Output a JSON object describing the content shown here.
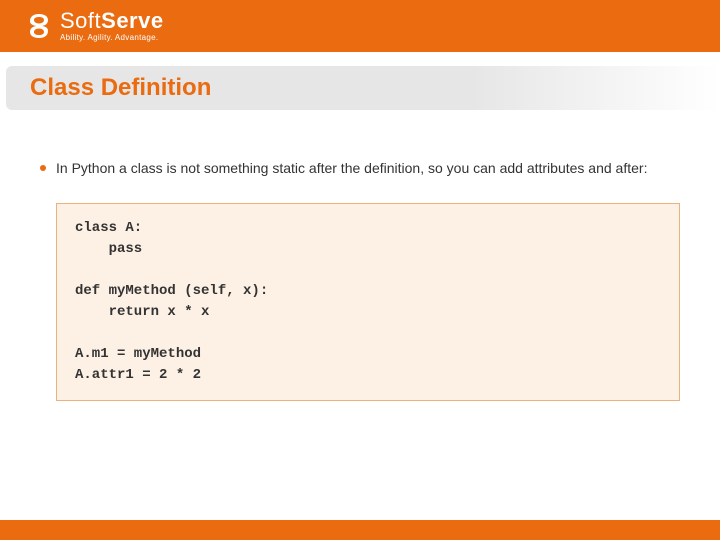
{
  "brand": {
    "name_light": "Soft",
    "name_bold": "Serve",
    "tagline": "Ability. Agility. Advantage."
  },
  "slide": {
    "title": "Class Definition",
    "bullet": "In Python a class is not something static after the definition, so you can add attributes and after:",
    "code": "class A:\n    pass\n\ndef myMethod (self, x):\n    return x * x\n\nA.m1 = myMethod\nA.attr1 = 2 * 2"
  }
}
